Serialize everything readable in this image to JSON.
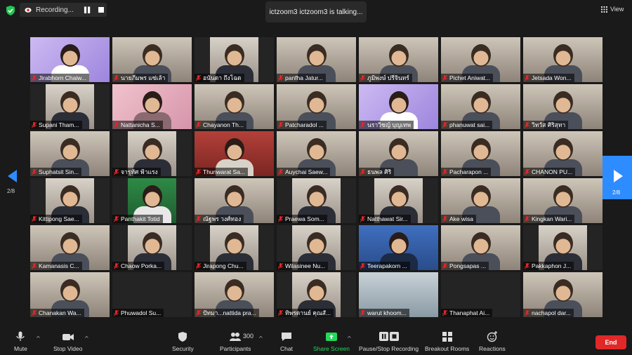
{
  "top_bar": {
    "recording_label": "Recording...",
    "talking_text": "ictzoom3 ictzoom3 is talking...",
    "view_label": "View"
  },
  "pagination": {
    "left_page": "2/8",
    "right_page": "2/8"
  },
  "colors": {
    "accent": "#2d8cff",
    "share_green": "#23d959",
    "end_red": "#e02828",
    "muted_mic": "#e02828"
  },
  "participants": [
    {
      "name": "Jirabhorn Chaiw...",
      "style": "purple"
    },
    {
      "name": "นายภีมพร แซ่เล้า",
      "style": "room"
    },
    {
      "name": "อนันดา ถึงโฉด",
      "style": "dark"
    },
    {
      "name": "panfha Jatur...",
      "style": "room"
    },
    {
      "name": "ภูมิพงษ์ ปรีจินทร์",
      "style": "room"
    },
    {
      "name": "Pichet Aniwat...",
      "style": "room"
    },
    {
      "name": "Jetsada Won...",
      "style": "room"
    },
    {
      "name": "Supani Tham...",
      "style": "dark"
    },
    {
      "name": "Nattanicha S...",
      "style": "pink"
    },
    {
      "name": "Chayanon Th...",
      "style": "room"
    },
    {
      "name": "Patcharadol ...",
      "style": "room"
    },
    {
      "name": "นราวิชญ์ บุญเทพ",
      "style": "purple"
    },
    {
      "name": "phanuwat sai...",
      "style": "room"
    },
    {
      "name": "วิทวัส ศิริสุทา",
      "style": "room"
    },
    {
      "name": "Suphatsit Sin...",
      "style": "room"
    },
    {
      "name": "จารุทัศ ฟ้าแรง",
      "style": "dark"
    },
    {
      "name": "Thunwarat Sa...",
      "style": "red"
    },
    {
      "name": "Auychai Saew...",
      "style": "room"
    },
    {
      "name": "ธนพล ศิริ",
      "style": "room"
    },
    {
      "name": "Pacharapon ...",
      "style": "room"
    },
    {
      "name": "CHANON PU...",
      "style": "room"
    },
    {
      "name": "Kittipong Sae...",
      "style": "dark"
    },
    {
      "name": "Panthakit Totid",
      "style": "green"
    },
    {
      "name": "ณัฐพร วงศ์ทอง",
      "style": "room"
    },
    {
      "name": "Praewa Som...",
      "style": "dark"
    },
    {
      "name": "Natthawat Sir...",
      "style": "dark"
    },
    {
      "name": "Ake wisa",
      "style": "room"
    },
    {
      "name": "Kingkan Wari...",
      "style": "room"
    },
    {
      "name": "Kamanasis C...",
      "style": "room"
    },
    {
      "name": "Chaow Porka...",
      "style": "dark"
    },
    {
      "name": "Jirapong Chu...",
      "style": "dark"
    },
    {
      "name": "Wilasinee Nu...",
      "style": "dark"
    },
    {
      "name": "Teerapakorn ...",
      "style": "blue"
    },
    {
      "name": "Pongsapas ...",
      "style": "room"
    },
    {
      "name": "Pakkaphon J...",
      "style": "dark"
    },
    {
      "name": "Chanakan Wa...",
      "style": "room"
    },
    {
      "name": "Phuwadol Su...",
      "style": "empty"
    },
    {
      "name": "ปัทมา...nattida pra...",
      "style": "room"
    },
    {
      "name": "ทิพรดานย์ คุณสั...",
      "style": "dark"
    },
    {
      "name": "warut khoom...",
      "style": "window"
    },
    {
      "name": "Thanaphat Ai...",
      "style": "empty"
    },
    {
      "name": "nachapol dar...",
      "style": "room"
    }
  ],
  "toolbar": {
    "mute": "Mute",
    "stop_video": "Stop Video",
    "security": "Security",
    "participants": "Participants",
    "participants_count": "300",
    "chat": "Chat",
    "share_screen": "Share Screen",
    "pause_recording": "Pause/Stop Recording",
    "breakout_rooms": "Breakout Rooms",
    "reactions": "Reactions",
    "end": "End"
  }
}
